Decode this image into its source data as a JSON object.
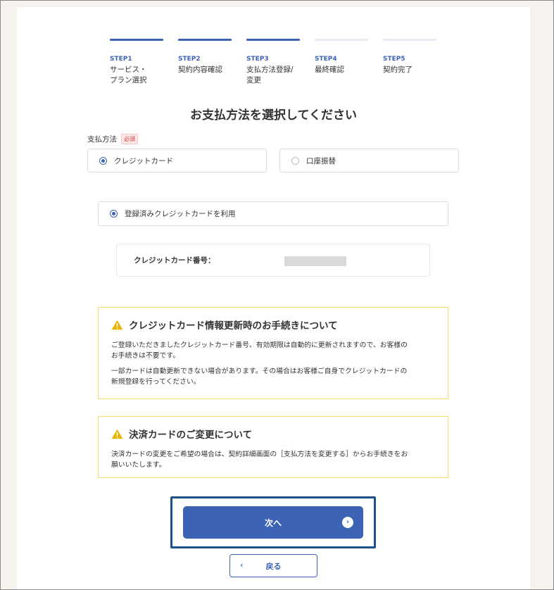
{
  "steps": [
    {
      "num": "STEP1",
      "label": "サービス・\nプラン選択",
      "active": true
    },
    {
      "num": "STEP2",
      "label": "契約内容確認",
      "active": true
    },
    {
      "num": "STEP3",
      "label": "支払方法登録/\n変更",
      "active": true
    },
    {
      "num": "STEP4",
      "label": "最終確認",
      "active": false
    },
    {
      "num": "STEP5",
      "label": "契約完了",
      "active": false
    }
  ],
  "page_title": "お支払方法を選択してください",
  "payment_method": {
    "label": "支払方法",
    "required": "必須",
    "options": [
      {
        "label": "クレジットカード",
        "selected": true
      },
      {
        "label": "口座振替",
        "selected": false
      }
    ]
  },
  "registered_card": {
    "option_label": "登録済みクレジットカードを利用",
    "number_label": "クレジットカード番号："
  },
  "notices": [
    {
      "title": "クレジットカード情報更新時のお手続きについて",
      "paragraphs": [
        "ご登録いただきましたクレジットカード番号、有効期限は自動的に更新されますので、お客様の\nお手続きは不要です。",
        "一部カードは自動更新できない場合があります。その場合はお客様ご自身でクレジットカードの\n新規登録を行ってください。"
      ]
    },
    {
      "title": "決済カードのご変更について",
      "paragraphs": [
        "決済カードの変更をご希望の場合は、契約詳細画面の［支払方法を変更する］からお手続きをお\n願いいたします。"
      ]
    }
  ],
  "buttons": {
    "next": "次へ",
    "next_icon": "›",
    "back": "戻る",
    "back_icon": "‹"
  },
  "colors": {
    "primary": "#3d63b5",
    "highlight_border": "#1d4f8a",
    "notice_border": "#f5dc6b",
    "warning_icon": "#e9b400",
    "required": "#d23b3b"
  }
}
